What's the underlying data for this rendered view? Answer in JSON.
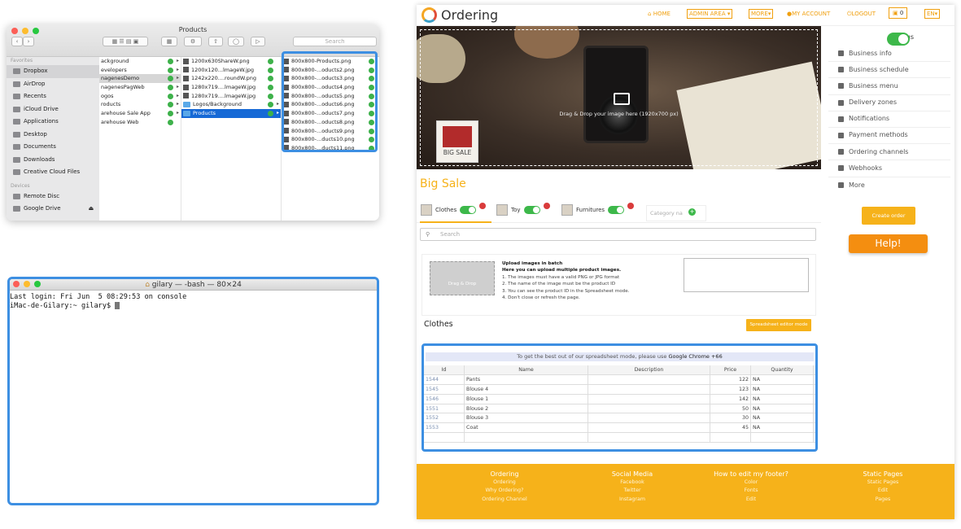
{
  "finder": {
    "title": "Products",
    "search_placeholder": "Search",
    "sidebar": {
      "favorites_header": "Favorites",
      "favorites": [
        "Dropbox",
        "AirDrop",
        "Recents",
        "iCloud Drive",
        "Applications",
        "Desktop",
        "Documents",
        "Downloads",
        "Creative Cloud Files"
      ],
      "devices_header": "Devices",
      "devices": [
        "Remote Disc",
        "Google Drive"
      ]
    },
    "col1": [
      "ackground",
      "evelopers",
      "nagenesDemo",
      "nagenesPagWeb",
      "ogos",
      "roducts",
      "arehouse Sale App",
      "arehouse Web"
    ],
    "col2": [
      "1200x630ShareW.png",
      "1200x120...lmageW.jpg",
      "1242x220....roundW.png",
      "1280x719....lmageW.jpg",
      "1280x719....lmageW.jpg",
      "Logos/Background",
      "Products"
    ],
    "col3": [
      "800x800-Products.png",
      "800x800-...oducts2.png",
      "800x800-...oducts3.png",
      "800x800-...oducts4.png",
      "800x800-...oducts5.png",
      "800x800-...oducts6.png",
      "800x800-...oducts7.png",
      "800x800-...oducts8.png",
      "800x800-...oducts9.png",
      "800x800-...ducts10.png",
      "800x800-...ducts11.png"
    ]
  },
  "terminal": {
    "title": "gilary — -bash — 80×24",
    "line1": "Last login: Fri Jun  5 08:29:53 on console",
    "line2": "iMac-de-Gilary:~ gilary$ "
  },
  "app": {
    "logo": "Ordering",
    "nav": {
      "home": "HOME",
      "admin": "ADMIN AREA",
      "more": "MORE",
      "account": "MY ACCOUNT",
      "logout": "LOGOUT",
      "cart": "0",
      "lang": "EN"
    },
    "hero_text": "Drag & Drop your image here (1920x700 px)",
    "bigsale_label": "BIG SALE",
    "status_label": "Status",
    "menu": [
      "Business info",
      "Business schedule",
      "Business menu",
      "Delivery zones",
      "Notifications",
      "Payment methods",
      "Ordering channels",
      "Webhooks",
      "More"
    ],
    "create_order": "Create order",
    "help": "Help!",
    "business_name": "Big Sale",
    "categories": [
      "Clothes",
      "Toy",
      "Furnitures"
    ],
    "category_placeholder": "Category na",
    "search_placeholder": "Search",
    "upload": {
      "drag": "Drag & Drop",
      "title": "Upload images in batch",
      "subtitle": "Here you can upload multiple product images.",
      "step1": "1. The images must have a valid PNG or JPG format",
      "step2": "2. The name of the image must be the product ID",
      "step3": "3. You can see the product ID in the Spreadsheet mode.",
      "step4": "4. Don't close or refresh the page."
    },
    "section_title": "Clothes",
    "spreadsheet_btn": "Spreadsheet editor mode",
    "table": {
      "note": "To get the best out of our spreadsheet mode, please use ",
      "note_bold": "Google Chrome +66",
      "headers": [
        "Id",
        "Name",
        "Description",
        "Price",
        "Quantity"
      ],
      "rows": [
        {
          "id": "1544",
          "name": "Pants",
          "desc": "",
          "price": "122",
          "qty": "NA"
        },
        {
          "id": "1545",
          "name": "Blouse 4",
          "desc": "",
          "price": "123",
          "qty": "NA"
        },
        {
          "id": "1546",
          "name": "Blouse 1",
          "desc": "",
          "price": "142",
          "qty": "NA"
        },
        {
          "id": "1551",
          "name": "Blouse 2",
          "desc": "",
          "price": "50",
          "qty": "NA"
        },
        {
          "id": "1552",
          "name": "Blouse 3",
          "desc": "",
          "price": "30",
          "qty": "NA"
        },
        {
          "id": "1553",
          "name": "Coat",
          "desc": "",
          "price": "45",
          "qty": "NA"
        },
        {
          "id": "",
          "name": "",
          "desc": "",
          "price": "",
          "qty": ""
        }
      ]
    },
    "footer": {
      "cols": [
        {
          "title": "Ordering",
          "items": [
            "Ordering",
            "Why Ordering?",
            "Ordering Channel"
          ]
        },
        {
          "title": "Social Media",
          "items": [
            "Facebook",
            "Twitter",
            "Instagram"
          ]
        },
        {
          "title": "How to edit my footer?",
          "items": [
            "Color",
            "Fonts",
            "Edit"
          ]
        },
        {
          "title": "Static Pages",
          "items": [
            "Static Pages",
            "Edit",
            "Pages"
          ]
        }
      ]
    }
  }
}
